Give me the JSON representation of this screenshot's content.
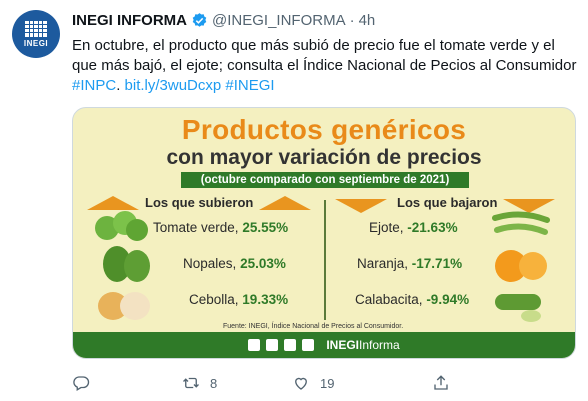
{
  "account": {
    "name": "INEGI INFORMA",
    "handle": "@INEGI_INFORMA",
    "separator": "·",
    "time": "4h",
    "avatar_text": "INEGI"
  },
  "tweet": {
    "text": "En octubre, el producto que más subió de precio fue el tomate verde y el que más bajó, el ejote; consulta el Índice Nacional de Pecios al Consumidor",
    "hashtag1": "#INPC",
    "link": "bit.ly/3wuDcxp",
    "hashtag2": "#INEGI"
  },
  "card": {
    "title_line1": "Productos genéricos",
    "title_line2": "con mayor variación de precios",
    "subtitle": "(octubre comparado con septiembre de 2021)",
    "left_header": "Los que subieron",
    "right_header": "Los que bajaron",
    "rose": [
      {
        "name": "Tomate verde,",
        "pct": "25.55%"
      },
      {
        "name": "Nopales,",
        "pct": "25.03%"
      },
      {
        "name": "Cebolla,",
        "pct": "19.33%"
      }
    ],
    "fell": [
      {
        "name": "Ejote,",
        "pct": "-21.63%"
      },
      {
        "name": "Naranja,",
        "pct": "-17.71%"
      },
      {
        "name": "Calabacita,",
        "pct": "-9.94%"
      }
    ],
    "source": "Fuente: INEGI, Índice Nacional de Precios al Consumidor.",
    "brand_bold": "INEGI",
    "brand_rest": "Informa"
  },
  "actions": {
    "reply_count": "",
    "retweet_count": "8",
    "like_count": "19"
  }
}
